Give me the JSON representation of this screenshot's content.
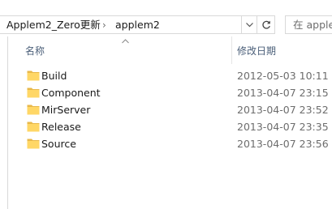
{
  "address": {
    "crumbs": [
      "Applem2_Zero更新",
      "applem2"
    ],
    "separator": "›"
  },
  "search": {
    "placeholder": "在 apple"
  },
  "columns": {
    "name": "名称",
    "date": "修改日期",
    "sorted_by": "name",
    "sort_icon": "sort-up-icon"
  },
  "files": [
    {
      "name": "Build",
      "date": "2012-05-03 10:11",
      "icon": "folder-icon"
    },
    {
      "name": "Component",
      "date": "2013-04-07 23:15",
      "icon": "folder-icon"
    },
    {
      "name": "MirServer",
      "date": "2013-04-07 23:52",
      "icon": "folder-icon"
    },
    {
      "name": "Release",
      "date": "2013-04-07 23:35",
      "icon": "folder-icon"
    },
    {
      "name": "Source",
      "date": "2013-04-07 23:56",
      "icon": "folder-icon"
    }
  ],
  "colors": {
    "folder": "#ffd766",
    "folder_dark": "#e8b84a",
    "header_text": "#4c607a",
    "date_text": "#6d6d6d"
  }
}
